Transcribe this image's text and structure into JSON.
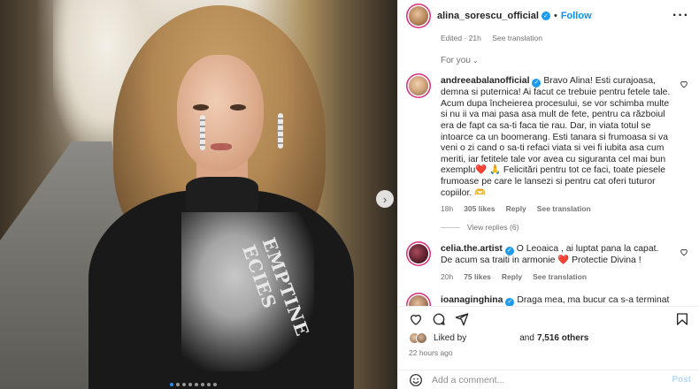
{
  "post": {
    "username": "alina_sorescu_official",
    "follow_label": "Follow",
    "separator": "•",
    "more_label": "···",
    "caption_meta": {
      "edited": "Edited · 21h",
      "see_translation": "See translation"
    },
    "for_you": "For you",
    "image_print_text": "EMPTINE ECIES",
    "carousel": {
      "count": 8,
      "active": 0
    }
  },
  "comments": [
    {
      "username": "andreeabalanofficial",
      "text": "Bravo Alina! Esti curajoasa, demna si puternica! Ai facut ce trebuie pentru fetele tale. Acum dupa încheierea procesului, se vor schimba multe si nu ii va mai pasa asa mult de fete, pentru ca războiul era de fapt ca sa-ti faca tie rau. Dar, in viata totul se intoarce ca un boomerang. Esti tanara si frumoasa si va veni o zi cand o sa-ti refaci viata si vei fi iubita asa cum meriti, iar fetitele tale vor avea cu siguranta cel mai bun exemplu❤️ 🙏 Felicitări pentru tot ce faci, toate piesele frumoase pe care le lansezi si pentru cat oferi tuturor copiilor. 🫶",
      "time": "18h",
      "likes": "305 likes",
      "reply": "Reply",
      "see_translation": "See translation"
    },
    {
      "username": "celia.the.artist",
      "text": "O Leoaica , ai luptat pana la capat. De acum sa traiti in armonie ❤️ Protectie Divina !",
      "time": "20h",
      "likes": "75 likes",
      "reply": "Reply",
      "see_translation": "See translation"
    },
    {
      "username": "ioanaginghina",
      "text": "Draga mea, ma bucur ca s-a terminat cu toate"
    }
  ],
  "view_replies": "View replies (6)",
  "likes_row": {
    "prefix": "Liked by",
    "suffix": "and",
    "count": "7,516 others"
  },
  "time_ago": "22 hours ago",
  "add_comment": {
    "placeholder": "Add a comment...",
    "post_label": "Post"
  },
  "colors": {
    "accent": "#0095f6",
    "verified": "#1d9bf0",
    "story_ring": "#d92d7a",
    "carousel_active": "#2b8df5"
  },
  "icons": [
    "heart-icon",
    "comment-icon",
    "share-icon",
    "bookmark-icon",
    "emoji-icon",
    "verified-icon",
    "more-icon",
    "chevron-right-icon",
    "chevron-down-icon"
  ]
}
